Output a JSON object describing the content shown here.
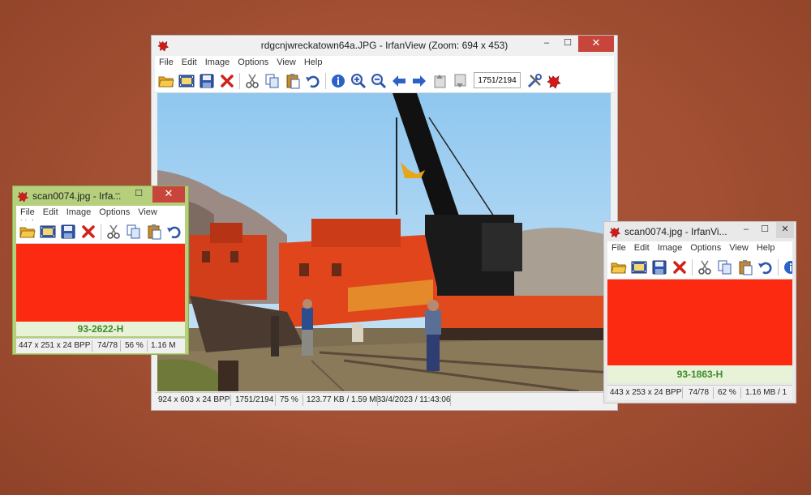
{
  "main_window": {
    "title": "rdgcnjwreckatown64a.JPG - IrfanView (Zoom: 694 x 453)",
    "menu": [
      "File",
      "Edit",
      "Image",
      "Options",
      "View",
      "Help"
    ],
    "page_field_value": "1751/2194",
    "status": {
      "dimensions": "924 x 603 x 24 BPP",
      "index": "1751/2194",
      "zoom": "75 %",
      "size": "123.77 KB / 1.59 MB",
      "datetime": "3/4/2023 / 11:43:06"
    }
  },
  "left_window": {
    "title": "scan0074.jpg - Irfa...",
    "menu": [
      "File",
      "Edit",
      "Image",
      "Options",
      "View",
      "Help"
    ],
    "caption": "93-2622-H",
    "status": {
      "dimensions": "447 x 251 x 24 BPP",
      "index": "74/78",
      "zoom": "56 %",
      "size": "1.16 M"
    }
  },
  "right_window": {
    "title": "scan0074.jpg - IrfanVi...",
    "menu": [
      "File",
      "Edit",
      "Image",
      "Options",
      "View",
      "Help"
    ],
    "caption": "93-1863-H",
    "status": {
      "dimensions": "443 x 253 x 24 BPP",
      "index": "74/78",
      "zoom": "62 %",
      "size": "1.16 MB / 1"
    }
  },
  "window_controls": {
    "minimize": "–",
    "maximize": "☐",
    "close": "✕"
  },
  "colors": {
    "desktop": "#a24f33",
    "scan_red": "#fb2a11",
    "caption_green": "#3e8a2c",
    "left_frame": "#b5cf7c",
    "close_button": "#c7453a"
  },
  "icons": [
    "open-folder-icon",
    "slideshow-icon",
    "save-icon",
    "delete-icon",
    "cut-icon",
    "copy-icon",
    "paste-icon",
    "undo-icon",
    "info-icon",
    "zoom-in-icon",
    "zoom-out-icon",
    "previous-icon",
    "next-icon",
    "first-page-icon",
    "last-page-icon",
    "settings-icon",
    "irfanview-icon"
  ]
}
